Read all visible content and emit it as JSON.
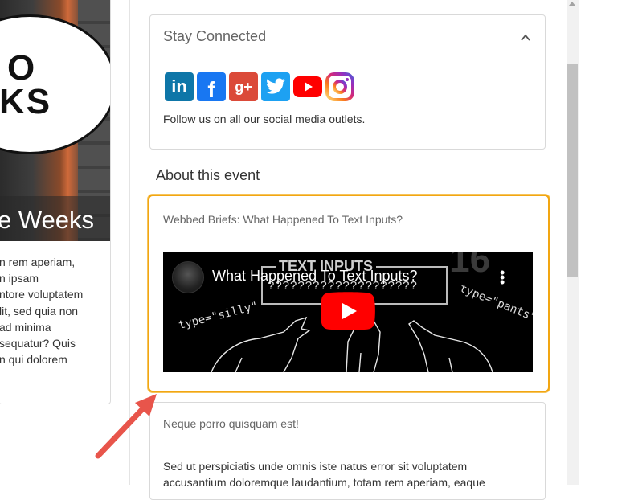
{
  "left_card": {
    "hero_oval_line1": "O",
    "hero_oval_line2": "KS",
    "hero_title": "e Weeks",
    "body_lines": [
      "n rem aperiam,",
      "n ipsam",
      "ntore voluptatem",
      "lit, sed quia non",
      "ad minima",
      "sequatur? Quis",
      "n qui dolorem"
    ]
  },
  "stay_connected": {
    "title": "Stay Connected",
    "icons": [
      "linkedin-icon",
      "facebook-icon",
      "google-plus-icon",
      "twitter-icon",
      "youtube-icon",
      "instagram-icon"
    ],
    "linkedin_glyph": "in",
    "facebook_glyph": "f",
    "google_plus_glyph": "g+",
    "description": "Follow us on all our social media outlets."
  },
  "about": {
    "heading": "About this event"
  },
  "event_card": {
    "title": "Webbed Briefs: What Happened To Text Inputs?",
    "video": {
      "title": "What Happened To Text Inputs?",
      "box_label": "TEXT INPUTS",
      "question_marks": "????????????????????",
      "left_caption": "type=\"silly\"",
      "right_caption": "type=\"pants\"",
      "bg_number": "16"
    },
    "highlight_color": "#f2a612"
  },
  "next_card": {
    "title": "Neque porro quisquam est!",
    "body_lines": [
      "Sed ut perspiciatis unde omnis iste natus error sit voluptatem",
      "accusantium doloremque laudantium, totam rem aperiam, eaque"
    ]
  },
  "annotation_arrow_color": "#e8554b"
}
